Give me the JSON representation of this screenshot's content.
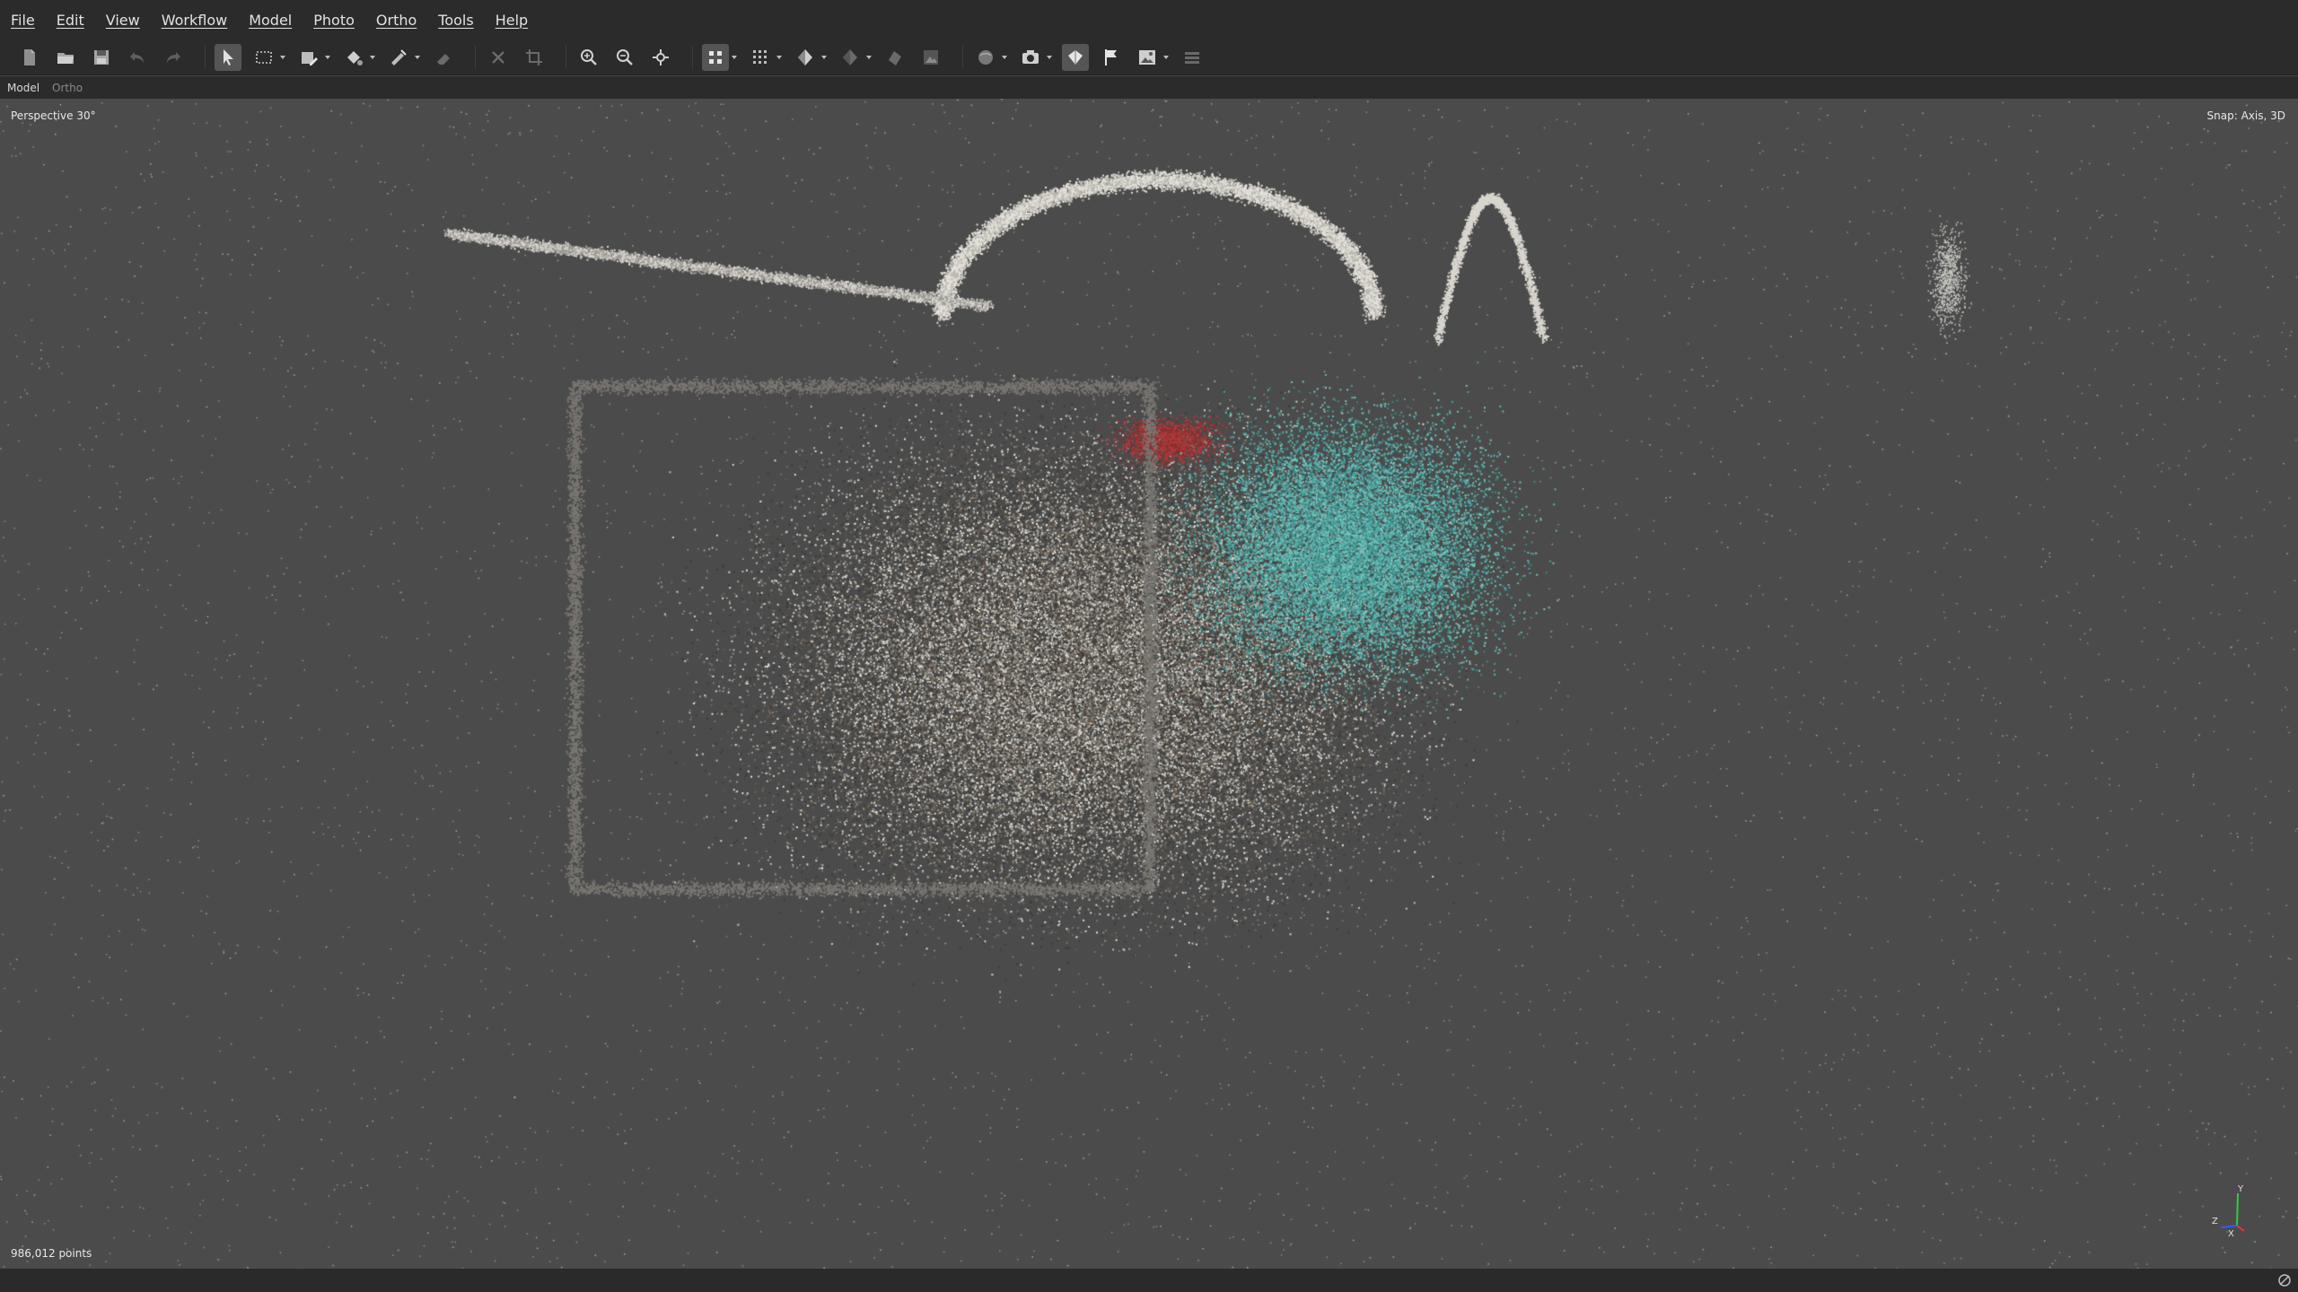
{
  "menu": [
    "File",
    "Edit",
    "View",
    "Workflow",
    "Model",
    "Photo",
    "Ortho",
    "Tools",
    "Help"
  ],
  "toolbar_icons": [
    {
      "name": "new-document-icon"
    },
    {
      "name": "open-folder-icon"
    },
    {
      "name": "save-icon"
    },
    {
      "name": "undo-icon"
    },
    {
      "name": "redo-icon"
    },
    {
      "name": "navigation-arrow-icon",
      "active": true
    },
    {
      "name": "rectangle-selection-icon",
      "caret": true
    },
    {
      "name": "draw-shape-icon",
      "caret": true
    },
    {
      "name": "paint-bucket-icon",
      "caret": true
    },
    {
      "name": "ruler-icon",
      "caret": true
    },
    {
      "name": "eraser-icon"
    },
    {
      "name": "delete-icon"
    },
    {
      "name": "crop-icon"
    },
    {
      "name": "zoom-in-icon"
    },
    {
      "name": "zoom-out-icon"
    },
    {
      "name": "reset-view-icon"
    },
    {
      "name": "point-cloud-icon",
      "caret": true
    },
    {
      "name": "grid-points-icon",
      "caret": true
    },
    {
      "name": "shaded-model-icon",
      "caret": true
    },
    {
      "name": "textured-model-icon",
      "caret": true
    },
    {
      "name": "tiled-model-icon"
    },
    {
      "name": "dem-icon"
    },
    {
      "name": "region-icon",
      "caret": true
    },
    {
      "name": "camera-icon",
      "caret": true
    },
    {
      "name": "shapes-icon"
    },
    {
      "name": "markers-flag-icon"
    },
    {
      "name": "image-icon",
      "caret": true
    },
    {
      "name": "layers-icon"
    }
  ],
  "view_tabs": [
    "Model",
    "Ortho"
  ],
  "viewport": {
    "projection": "Perspective 30°",
    "snap": "Snap: Axis, 3D",
    "point_count": "986,012 points"
  },
  "axis_labels": {
    "x": "X",
    "y": "Y",
    "z": "Z"
  }
}
